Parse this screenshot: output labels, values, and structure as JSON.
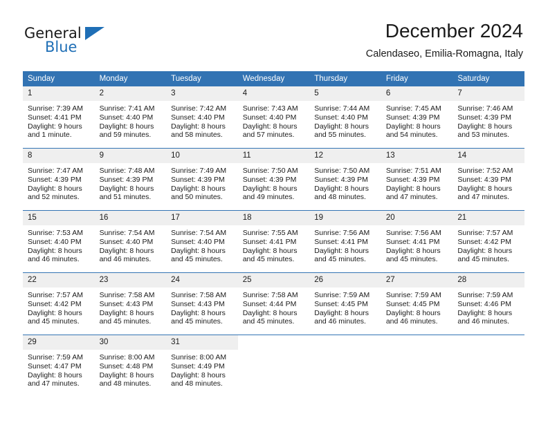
{
  "brand": {
    "name_part1": "General",
    "name_part2": "Blue",
    "triangle_icon": "triangle-logo-icon",
    "accent_color": "#1f6fb6"
  },
  "header": {
    "title": "December 2024",
    "subtitle": "Calendaseo, Emilia-Romagna, Italy"
  },
  "colors": {
    "header_blue": "#3273b3",
    "daynum_background": "#efefef",
    "text": "#1a1a1a"
  },
  "calendar": {
    "weekday_headers": [
      "Sunday",
      "Monday",
      "Tuesday",
      "Wednesday",
      "Thursday",
      "Friday",
      "Saturday"
    ],
    "weeks": [
      [
        {
          "day": "1",
          "sunrise": "Sunrise: 7:39 AM",
          "sunset": "Sunset: 4:41 PM",
          "daylight_line1": "Daylight: 9 hours",
          "daylight_line2": "and 1 minute."
        },
        {
          "day": "2",
          "sunrise": "Sunrise: 7:41 AM",
          "sunset": "Sunset: 4:40 PM",
          "daylight_line1": "Daylight: 8 hours",
          "daylight_line2": "and 59 minutes."
        },
        {
          "day": "3",
          "sunrise": "Sunrise: 7:42 AM",
          "sunset": "Sunset: 4:40 PM",
          "daylight_line1": "Daylight: 8 hours",
          "daylight_line2": "and 58 minutes."
        },
        {
          "day": "4",
          "sunrise": "Sunrise: 7:43 AM",
          "sunset": "Sunset: 4:40 PM",
          "daylight_line1": "Daylight: 8 hours",
          "daylight_line2": "and 57 minutes."
        },
        {
          "day": "5",
          "sunrise": "Sunrise: 7:44 AM",
          "sunset": "Sunset: 4:40 PM",
          "daylight_line1": "Daylight: 8 hours",
          "daylight_line2": "and 55 minutes."
        },
        {
          "day": "6",
          "sunrise": "Sunrise: 7:45 AM",
          "sunset": "Sunset: 4:39 PM",
          "daylight_line1": "Daylight: 8 hours",
          "daylight_line2": "and 54 minutes."
        },
        {
          "day": "7",
          "sunrise": "Sunrise: 7:46 AM",
          "sunset": "Sunset: 4:39 PM",
          "daylight_line1": "Daylight: 8 hours",
          "daylight_line2": "and 53 minutes."
        }
      ],
      [
        {
          "day": "8",
          "sunrise": "Sunrise: 7:47 AM",
          "sunset": "Sunset: 4:39 PM",
          "daylight_line1": "Daylight: 8 hours",
          "daylight_line2": "and 52 minutes."
        },
        {
          "day": "9",
          "sunrise": "Sunrise: 7:48 AM",
          "sunset": "Sunset: 4:39 PM",
          "daylight_line1": "Daylight: 8 hours",
          "daylight_line2": "and 51 minutes."
        },
        {
          "day": "10",
          "sunrise": "Sunrise: 7:49 AM",
          "sunset": "Sunset: 4:39 PM",
          "daylight_line1": "Daylight: 8 hours",
          "daylight_line2": "and 50 minutes."
        },
        {
          "day": "11",
          "sunrise": "Sunrise: 7:50 AM",
          "sunset": "Sunset: 4:39 PM",
          "daylight_line1": "Daylight: 8 hours",
          "daylight_line2": "and 49 minutes."
        },
        {
          "day": "12",
          "sunrise": "Sunrise: 7:50 AM",
          "sunset": "Sunset: 4:39 PM",
          "daylight_line1": "Daylight: 8 hours",
          "daylight_line2": "and 48 minutes."
        },
        {
          "day": "13",
          "sunrise": "Sunrise: 7:51 AM",
          "sunset": "Sunset: 4:39 PM",
          "daylight_line1": "Daylight: 8 hours",
          "daylight_line2": "and 47 minutes."
        },
        {
          "day": "14",
          "sunrise": "Sunrise: 7:52 AM",
          "sunset": "Sunset: 4:39 PM",
          "daylight_line1": "Daylight: 8 hours",
          "daylight_line2": "and 47 minutes."
        }
      ],
      [
        {
          "day": "15",
          "sunrise": "Sunrise: 7:53 AM",
          "sunset": "Sunset: 4:40 PM",
          "daylight_line1": "Daylight: 8 hours",
          "daylight_line2": "and 46 minutes."
        },
        {
          "day": "16",
          "sunrise": "Sunrise: 7:54 AM",
          "sunset": "Sunset: 4:40 PM",
          "daylight_line1": "Daylight: 8 hours",
          "daylight_line2": "and 46 minutes."
        },
        {
          "day": "17",
          "sunrise": "Sunrise: 7:54 AM",
          "sunset": "Sunset: 4:40 PM",
          "daylight_line1": "Daylight: 8 hours",
          "daylight_line2": "and 45 minutes."
        },
        {
          "day": "18",
          "sunrise": "Sunrise: 7:55 AM",
          "sunset": "Sunset: 4:41 PM",
          "daylight_line1": "Daylight: 8 hours",
          "daylight_line2": "and 45 minutes."
        },
        {
          "day": "19",
          "sunrise": "Sunrise: 7:56 AM",
          "sunset": "Sunset: 4:41 PM",
          "daylight_line1": "Daylight: 8 hours",
          "daylight_line2": "and 45 minutes."
        },
        {
          "day": "20",
          "sunrise": "Sunrise: 7:56 AM",
          "sunset": "Sunset: 4:41 PM",
          "daylight_line1": "Daylight: 8 hours",
          "daylight_line2": "and 45 minutes."
        },
        {
          "day": "21",
          "sunrise": "Sunrise: 7:57 AM",
          "sunset": "Sunset: 4:42 PM",
          "daylight_line1": "Daylight: 8 hours",
          "daylight_line2": "and 45 minutes."
        }
      ],
      [
        {
          "day": "22",
          "sunrise": "Sunrise: 7:57 AM",
          "sunset": "Sunset: 4:42 PM",
          "daylight_line1": "Daylight: 8 hours",
          "daylight_line2": "and 45 minutes."
        },
        {
          "day": "23",
          "sunrise": "Sunrise: 7:58 AM",
          "sunset": "Sunset: 4:43 PM",
          "daylight_line1": "Daylight: 8 hours",
          "daylight_line2": "and 45 minutes."
        },
        {
          "day": "24",
          "sunrise": "Sunrise: 7:58 AM",
          "sunset": "Sunset: 4:43 PM",
          "daylight_line1": "Daylight: 8 hours",
          "daylight_line2": "and 45 minutes."
        },
        {
          "day": "25",
          "sunrise": "Sunrise: 7:58 AM",
          "sunset": "Sunset: 4:44 PM",
          "daylight_line1": "Daylight: 8 hours",
          "daylight_line2": "and 45 minutes."
        },
        {
          "day": "26",
          "sunrise": "Sunrise: 7:59 AM",
          "sunset": "Sunset: 4:45 PM",
          "daylight_line1": "Daylight: 8 hours",
          "daylight_line2": "and 46 minutes."
        },
        {
          "day": "27",
          "sunrise": "Sunrise: 7:59 AM",
          "sunset": "Sunset: 4:45 PM",
          "daylight_line1": "Daylight: 8 hours",
          "daylight_line2": "and 46 minutes."
        },
        {
          "day": "28",
          "sunrise": "Sunrise: 7:59 AM",
          "sunset": "Sunset: 4:46 PM",
          "daylight_line1": "Daylight: 8 hours",
          "daylight_line2": "and 46 minutes."
        }
      ],
      [
        {
          "day": "29",
          "sunrise": "Sunrise: 7:59 AM",
          "sunset": "Sunset: 4:47 PM",
          "daylight_line1": "Daylight: 8 hours",
          "daylight_line2": "and 47 minutes."
        },
        {
          "day": "30",
          "sunrise": "Sunrise: 8:00 AM",
          "sunset": "Sunset: 4:48 PM",
          "daylight_line1": "Daylight: 8 hours",
          "daylight_line2": "and 48 minutes."
        },
        {
          "day": "31",
          "sunrise": "Sunrise: 8:00 AM",
          "sunset": "Sunset: 4:49 PM",
          "daylight_line1": "Daylight: 8 hours",
          "daylight_line2": "and 48 minutes."
        },
        {
          "day": "",
          "sunrise": "",
          "sunset": "",
          "daylight_line1": "",
          "daylight_line2": ""
        },
        {
          "day": "",
          "sunrise": "",
          "sunset": "",
          "daylight_line1": "",
          "daylight_line2": ""
        },
        {
          "day": "",
          "sunrise": "",
          "sunset": "",
          "daylight_line1": "",
          "daylight_line2": ""
        },
        {
          "day": "",
          "sunrise": "",
          "sunset": "",
          "daylight_line1": "",
          "daylight_line2": ""
        }
      ]
    ]
  }
}
